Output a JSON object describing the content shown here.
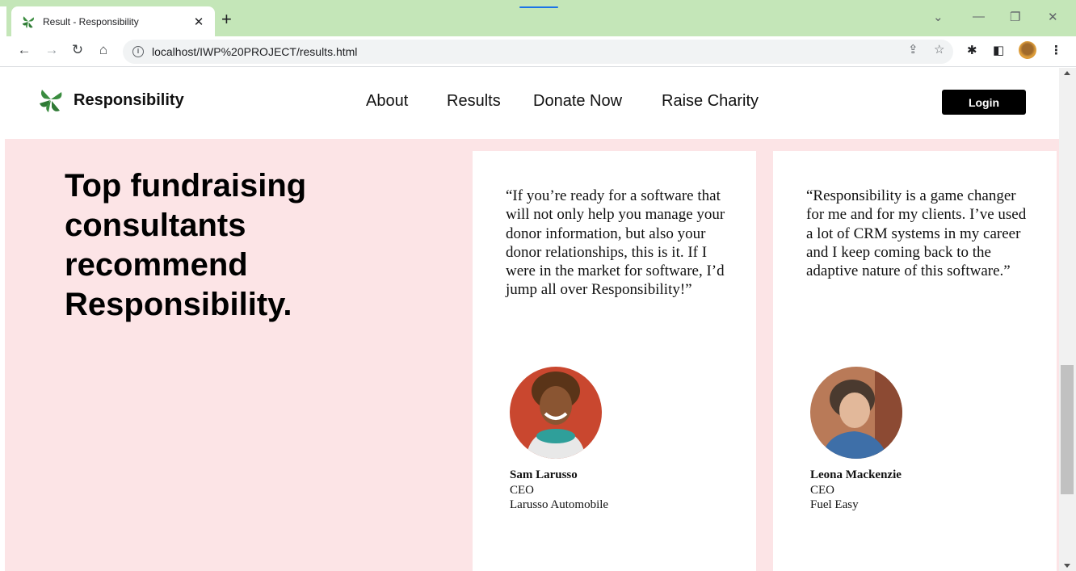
{
  "browser": {
    "tab_title": "Result - Responsibility",
    "url": "localhost/IWP%20PROJECT/results.html",
    "icons": [
      "back-arrow-icon",
      "forward-arrow-icon",
      "reload-icon",
      "home-icon",
      "info-icon",
      "share-icon",
      "star-icon",
      "extensions-icon",
      "side-panel-icon",
      "profile-avatar",
      "menu-icon"
    ]
  },
  "site": {
    "brand": "Responsibility",
    "nav": {
      "about": "About",
      "results": "Results",
      "donate": "Donate Now",
      "raise": "Raise Charity"
    },
    "login": "Login"
  },
  "main": {
    "headline": "Top fundraising consultants recommend Responsibility.",
    "testimonials": [
      {
        "quote": "“If you’re ready for a software that will not only help you manage your donor information, but also your donor relationships, this is it. If I were in the market for software, I’d jump all over Responsibility!”",
        "name": "Sam Larusso",
        "role": "CEO",
        "company": "Larusso Automobile"
      },
      {
        "quote": "“Responsibility is a game changer for me and for my clients. I’ve used a lot of CRM systems in my career and I keep coming back to the adaptive nature of this software.”",
        "name": "Leona Mackenzie",
        "role": "CEO",
        "company": "Fuel Easy"
      }
    ]
  },
  "colors": {
    "tabstrip": "#c4e6b8",
    "content_bg": "#fce4e6",
    "logo_green": "#3a8c3f",
    "login_bg": "#000000"
  }
}
